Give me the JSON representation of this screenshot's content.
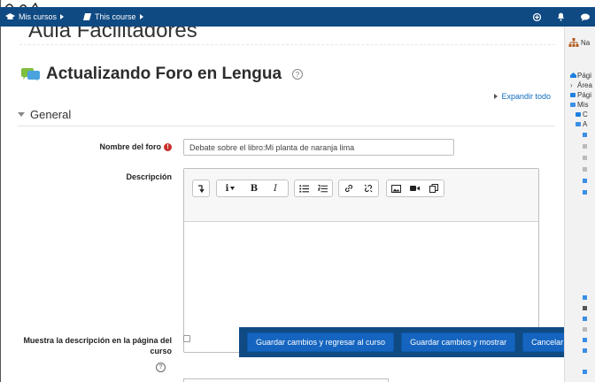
{
  "navbar": {
    "my_courses": "Mis cursos",
    "this_course": "This course"
  },
  "header": {
    "course_title": "Aula Facilitadores"
  },
  "page": {
    "title": "Actualizando Foro en Lengua",
    "expand_all": "Expandir todo",
    "section_general": "General"
  },
  "form": {
    "forum_name_label": "Nombre del foro",
    "forum_name_value": "Debate sobre el libro:Mi planta de naranja lima",
    "description_label": "Descripción",
    "show_description_label_line1": "Muestra la descripción en la página del",
    "show_description_label_line2": "curso"
  },
  "editor": {
    "toolbar": [
      "expand-toolbar",
      "paragraph-style",
      "bold",
      "italic",
      "unordered-list",
      "ordered-list",
      "link",
      "unlink",
      "image",
      "media",
      "manage-files"
    ]
  },
  "footer": {
    "save_return": "Guardar cambios y regresar al curso",
    "save_display": "Guardar cambios y mostrar",
    "cancel": "Cancelar"
  },
  "drawer": {
    "nav_label": "Na",
    "items": [
      "Pági",
      "Área",
      "Pági",
      "Mis",
      "C",
      "A"
    ]
  },
  "colors": {
    "navbar": "#0f4a83",
    "link": "#0f6cbf",
    "button": "#1565c0",
    "required": "#c9302c"
  }
}
